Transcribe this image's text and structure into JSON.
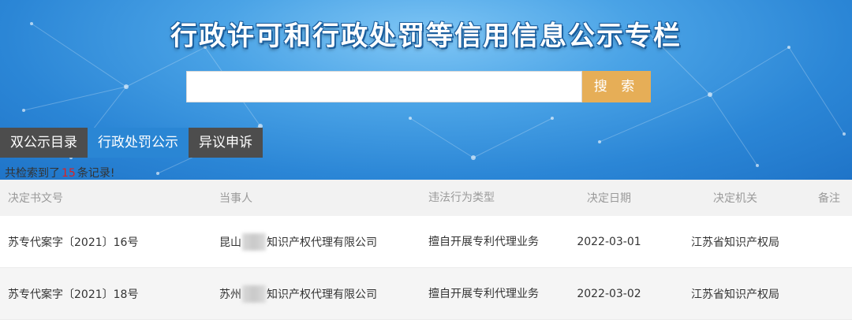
{
  "header": {
    "title": "行政许可和行政处罚等信用信息公示专栏"
  },
  "search": {
    "value": "",
    "placeholder": "",
    "button_label": "搜 索"
  },
  "tabs": [
    {
      "label": "双公示目录",
      "active": false
    },
    {
      "label": "行政处罚公示",
      "active": true
    },
    {
      "label": "异议申诉",
      "active": false
    }
  ],
  "result": {
    "prefix": "共检索到了",
    "count": "15",
    "suffix": "条记录!"
  },
  "table": {
    "columns": [
      "决定书文号",
      "当事人",
      "违法行为类型",
      "决定日期",
      "决定机关",
      "备注"
    ],
    "rows": [
      {
        "doc_no": "苏专代案字〔2021〕16号",
        "party_prefix": "昆山",
        "party_suffix": "知识产权代理有限公司",
        "violation": "擅自开展专利代理业务",
        "date": "2022-03-01",
        "authority": "江苏省知识产权局",
        "note": ""
      },
      {
        "doc_no": "苏专代案字〔2021〕18号",
        "party_prefix": "苏州",
        "party_suffix": "知识产权代理有限公司",
        "violation": "擅自开展专利代理业务",
        "date": "2022-03-02",
        "authority": "江苏省知识产权局",
        "note": ""
      }
    ]
  },
  "colors": {
    "hero_blue": "#2b86d6",
    "search_button": "#e6ae57",
    "tab_dark": "#4d4d4d",
    "tab_active": "#2a86d4",
    "count_red": "#e02020"
  }
}
